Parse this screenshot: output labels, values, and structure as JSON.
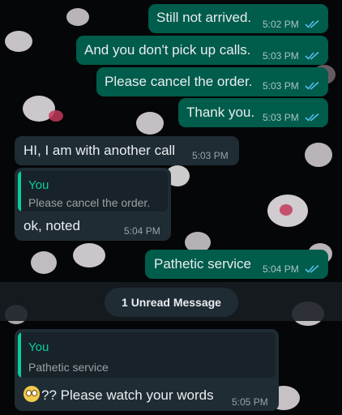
{
  "theme": {
    "outgoing_bubble": "#005c4b",
    "incoming_bubble": "#1f2c34",
    "quote_accent": "#06cf9c",
    "read_ticks": "#53bdeb"
  },
  "messages": {
    "m1": {
      "text": "Still not arrived.",
      "time": "5:02 PM",
      "status": "read-ticks-icon"
    },
    "m2": {
      "text": "And you don't pick up calls.",
      "time": "5:03 PM",
      "status": "read-ticks-icon"
    },
    "m3": {
      "text": "Please cancel the order.",
      "time": "5:03 PM",
      "status": "read-ticks-icon"
    },
    "m4": {
      "text": "Thank you.",
      "time": "5:03 PM",
      "status": "read-ticks-icon"
    },
    "m5": {
      "text": "HI, I am with another call",
      "time": "5:03 PM"
    },
    "m6": {
      "quote_author": "You",
      "quote_text": "Please cancel the order.",
      "text": "ok, noted",
      "time": "5:04 PM"
    },
    "m7": {
      "text": "Pathetic service",
      "time": "5:04 PM",
      "status": "read-ticks-icon"
    },
    "m8": {
      "quote_author": "You",
      "quote_text": "Pathetic service",
      "emoji": "face-with-rolling-eyes-emoji",
      "text": "?? Please watch your words",
      "time": "5:05 PM"
    }
  },
  "unread": {
    "label": "1 Unread Message"
  }
}
